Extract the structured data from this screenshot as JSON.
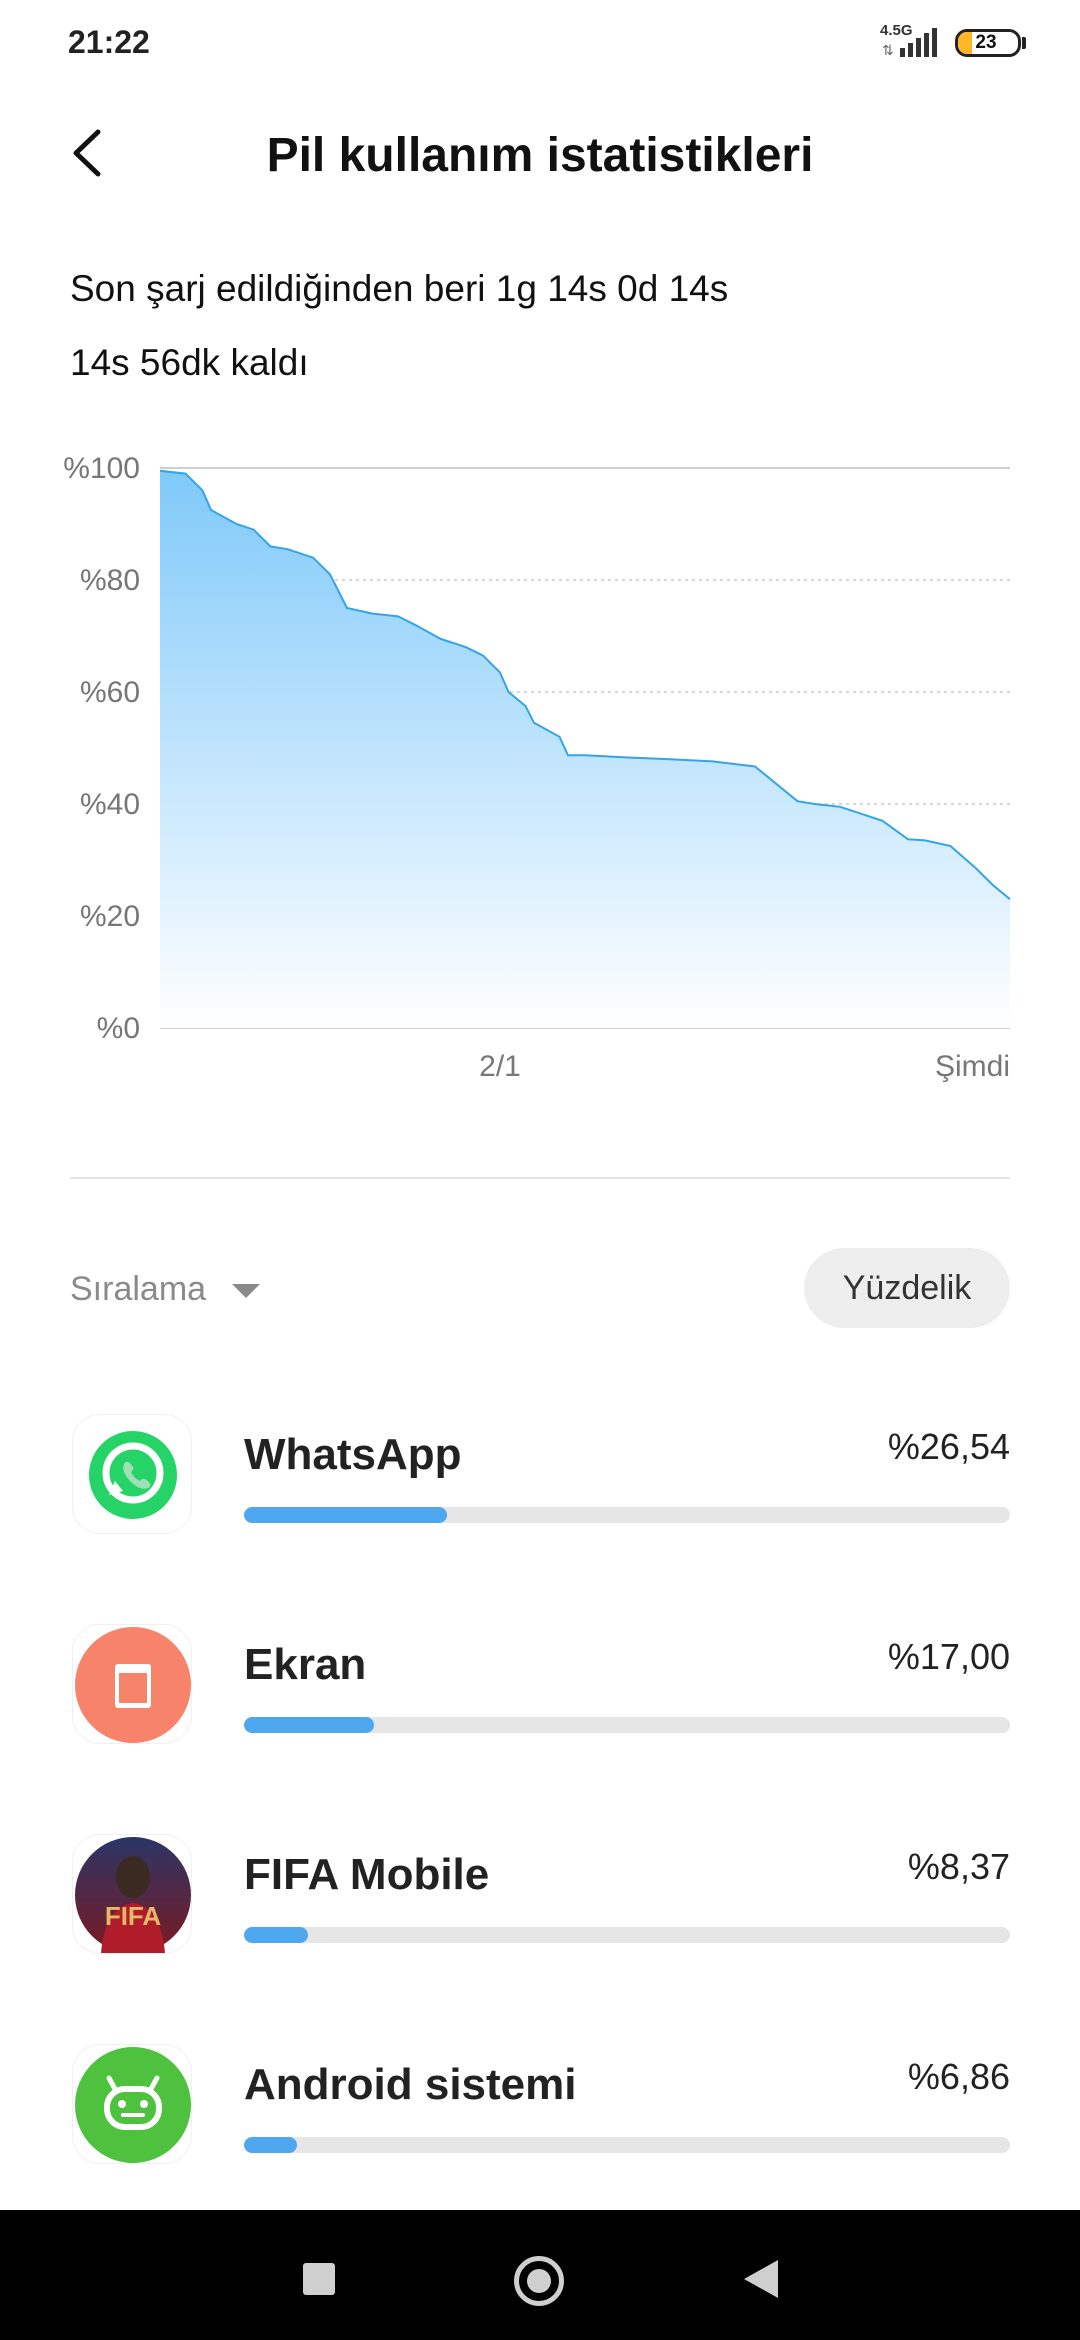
{
  "status_bar": {
    "time": "21:22",
    "network": "4.5G",
    "battery_level": "23",
    "battery_fraction": 0.23
  },
  "header": {
    "title": "Pil kullanım istatistikleri"
  },
  "summary": {
    "line1": "Son şarj edildiğinden beri 1g 14s 0d 14s",
    "line2": "14s 56dk kaldı"
  },
  "chart_data": {
    "type": "area",
    "y_tick_labels": [
      "%100",
      "%80",
      "%60",
      "%40",
      "%20",
      "%0"
    ],
    "y_ticks": [
      100,
      80,
      60,
      40,
      20,
      0
    ],
    "ylim": [
      0,
      100
    ],
    "xlim": [
      0,
      1
    ],
    "x_tick_labels": [
      "2/1",
      "Şimdi"
    ],
    "x_tick_positions": [
      0.4,
      1.0
    ],
    "x": [
      0.0,
      0.03,
      0.05,
      0.06,
      0.09,
      0.11,
      0.13,
      0.15,
      0.18,
      0.2,
      0.22,
      0.25,
      0.28,
      0.3,
      0.33,
      0.36,
      0.38,
      0.4,
      0.41,
      0.43,
      0.44,
      0.47,
      0.48,
      0.5,
      0.55,
      0.6,
      0.65,
      0.7,
      0.75,
      0.77,
      0.8,
      0.85,
      0.88,
      0.9,
      0.93,
      0.96,
      0.98,
      1.0
    ],
    "values": [
      99.5,
      99.0,
      96.0,
      92.5,
      90.0,
      89.0,
      86.0,
      85.5,
      84.0,
      81.0,
      75.0,
      74.0,
      73.5,
      72.0,
      69.5,
      68.0,
      66.5,
      63.5,
      60.0,
      57.5,
      54.5,
      52.0,
      48.7,
      48.7,
      48.3,
      48.0,
      47.6,
      46.7,
      40.5,
      40.0,
      39.5,
      37.0,
      33.7,
      33.5,
      32.5,
      28.5,
      25.5,
      23.0
    ],
    "color": "#34a4e6",
    "fill_top": "#7fc9fa",
    "fill_bottom": "#ffffff",
    "grid": true
  },
  "sort": {
    "label": "Sıralama",
    "mode_button": "Yüzdelik"
  },
  "apps": [
    {
      "name": "WhatsApp",
      "percent": "%26,54",
      "value": 26.54,
      "icon": "whatsapp-icon"
    },
    {
      "name": "Ekran",
      "percent": "%17,00",
      "value": 17.0,
      "icon": "screen-icon"
    },
    {
      "name": "FIFA Mobile",
      "percent": "%8,37",
      "value": 8.37,
      "icon": "fifa-mobile-icon",
      "icon_text": "FIFA"
    },
    {
      "name": "Android sistemi",
      "percent": "%6,86",
      "value": 6.86,
      "icon": "android-system-icon"
    }
  ],
  "bar_scale_max": 100,
  "colors": {
    "bar": "#4ea8ef",
    "track": "#e6e6e6",
    "whatsapp": "#25d366",
    "ekran": "#f6836a",
    "android": "#4ec23f"
  }
}
